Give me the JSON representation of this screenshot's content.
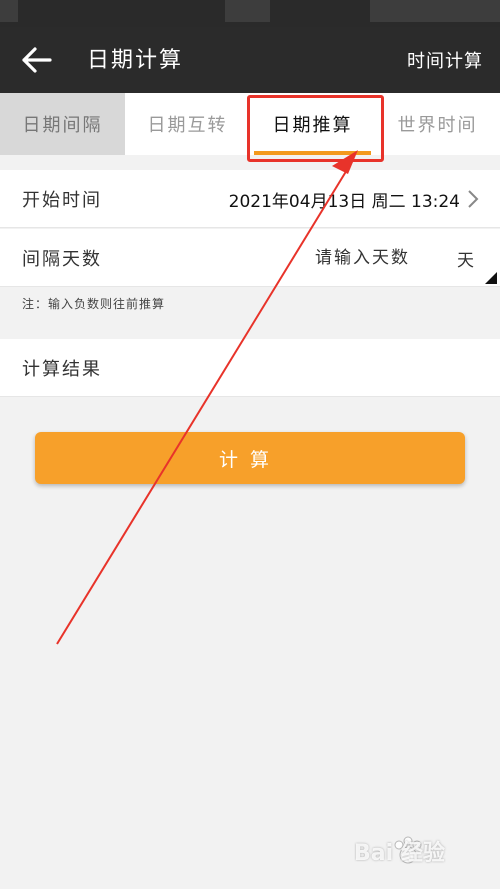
{
  "header": {
    "title": "日期计算",
    "action_label": "时间计算"
  },
  "tabs": [
    {
      "label": "日期间隔"
    },
    {
      "label": "日期互转"
    },
    {
      "label": "日期推算"
    },
    {
      "label": "世界时间"
    }
  ],
  "form": {
    "start_time_label": "开始时间",
    "start_time_value": "2021年04月13日  周二  13:24",
    "interval_label": "间隔天数",
    "interval_placeholder": "请输入天数",
    "interval_unit": "天",
    "note": "注：输入负数则往前推算",
    "result_label": "计算结果"
  },
  "calc_button": {
    "label": "计算"
  },
  "watermark": {
    "text": "Bai 经验"
  },
  "colors": {
    "accent": "#f39a1e",
    "button": "#f7a02a",
    "header_bg": "#2b2b2b",
    "annotation": "#e8332a"
  }
}
